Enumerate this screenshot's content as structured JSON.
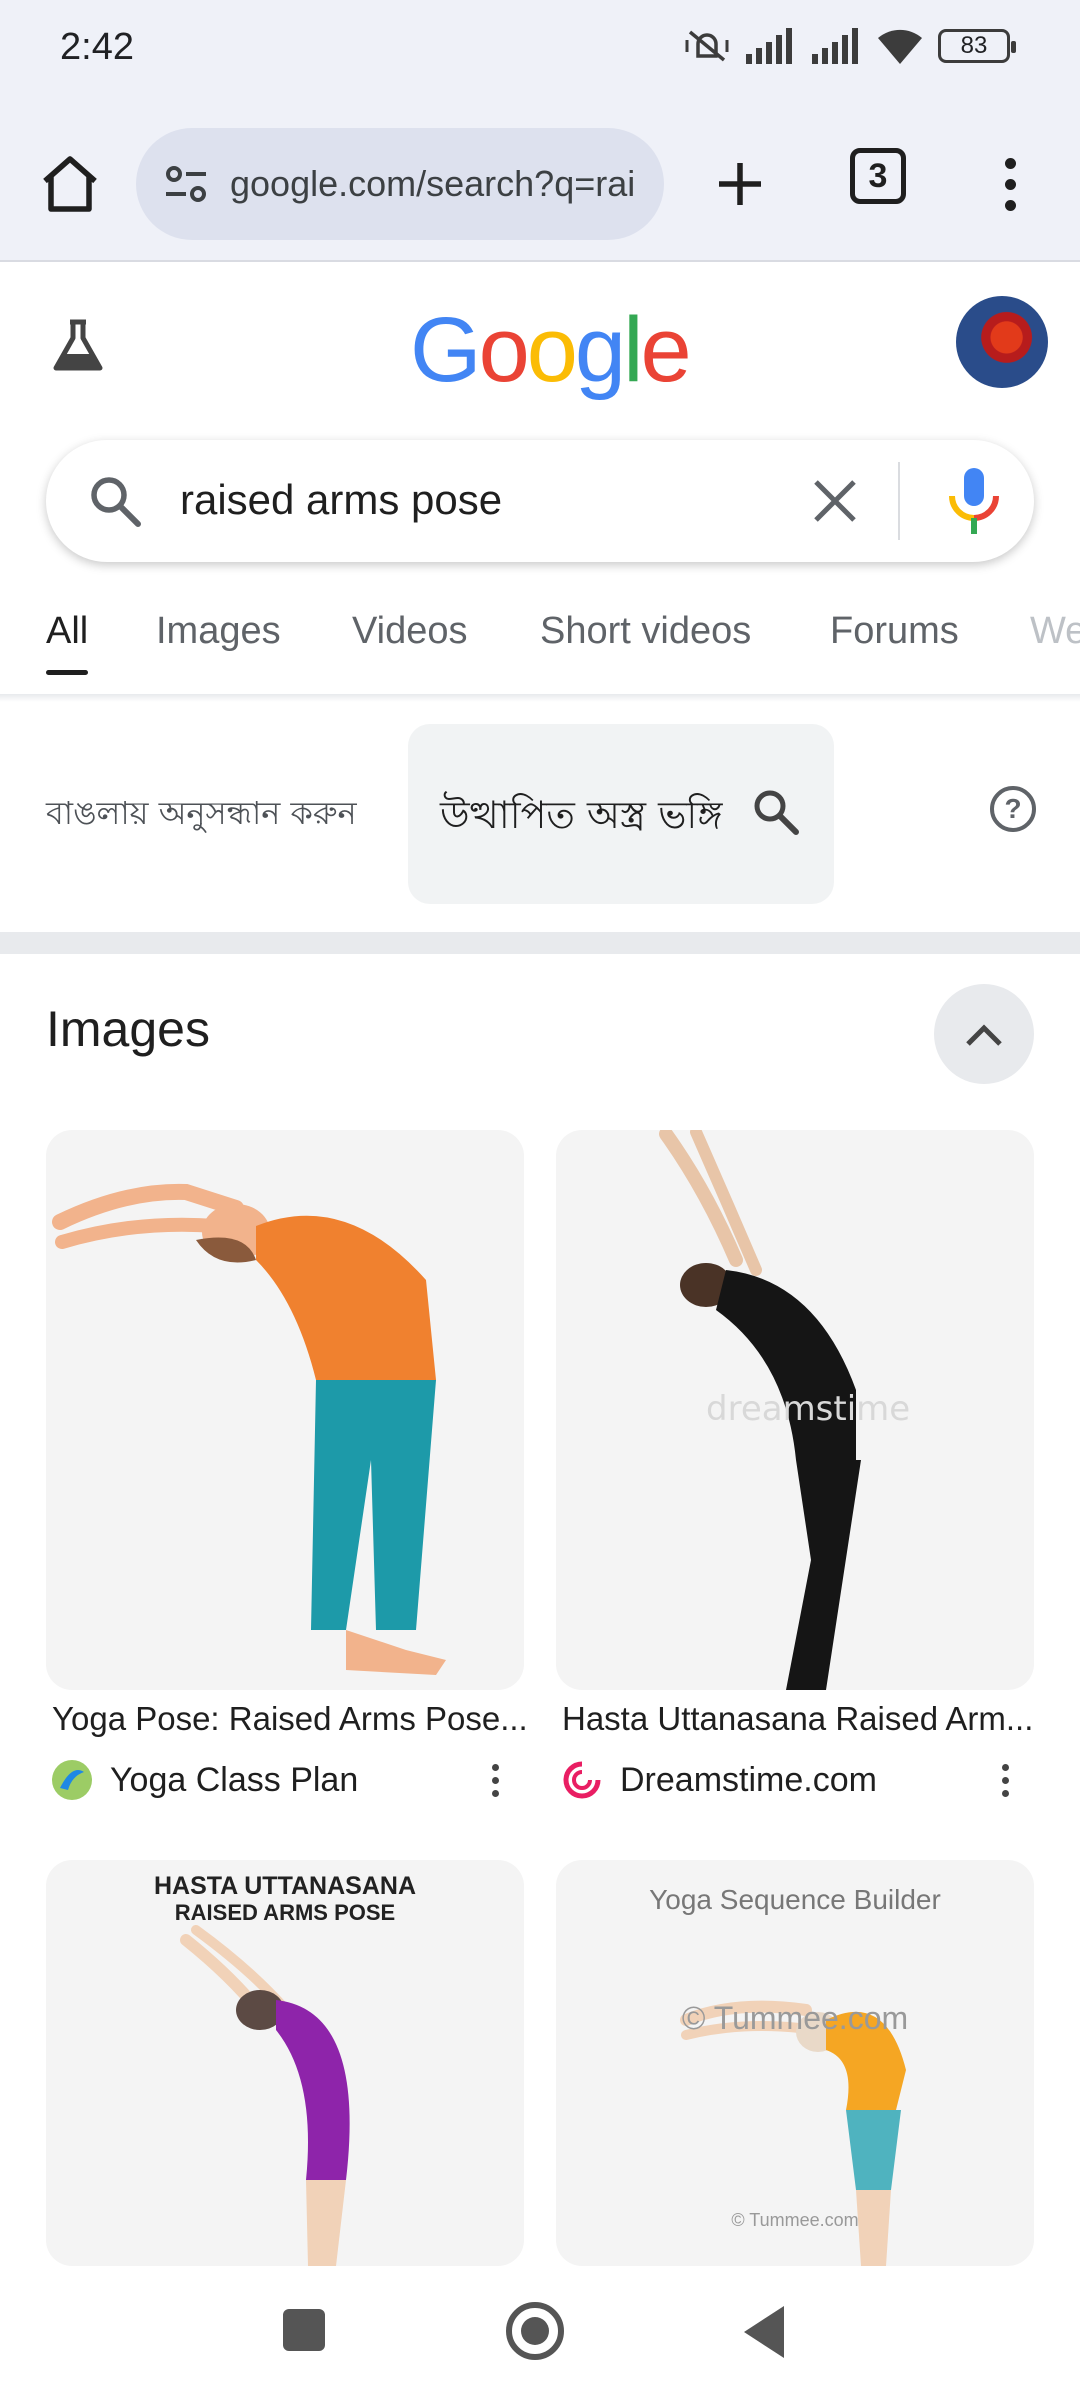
{
  "status_bar": {
    "time": "2:42",
    "battery": "83"
  },
  "browser": {
    "url": "google.com/search?q=rai",
    "tab_count": "3"
  },
  "google": {
    "logo": [
      "G",
      "o",
      "o",
      "g",
      "l",
      "e"
    ],
    "logo_colors": [
      "#4285F4",
      "#EA4335",
      "#FBBC05",
      "#4285F4",
      "#34A853",
      "#EA4335"
    ]
  },
  "search": {
    "query": "raised arms pose"
  },
  "tabs": [
    {
      "label": "All",
      "active": true
    },
    {
      "label": "Images"
    },
    {
      "label": "Videos"
    },
    {
      "label": "Short videos"
    },
    {
      "label": "Forums"
    },
    {
      "label": "We"
    }
  ],
  "language_suggestion": {
    "label": "বাঙলায় অনুসন্ধান করুন",
    "chip_text": "উত্থাপিত অস্ত্র ভঙ্গি"
  },
  "images_section": {
    "title": "Images",
    "results": [
      {
        "title": "Yoga Pose: Raised Arms Pose...",
        "source": "Yoga Class Plan"
      },
      {
        "title": "Hasta Uttanasana Raised Arm...",
        "source": "Dreamstime.com"
      },
      {
        "overlay_line1": "HASTA UTTANASANA",
        "overlay_line2": "RAISED ARMS POSE"
      },
      {
        "overlay_line1": "Yoga Sequence Builder",
        "watermark": "© Tummee.com",
        "watermark_small": "© Tummee.com"
      }
    ]
  },
  "colors": {
    "accent": "#1a73e8",
    "chrome_bg": "#eff1f8",
    "omnibox_bg": "#dde1ee"
  }
}
